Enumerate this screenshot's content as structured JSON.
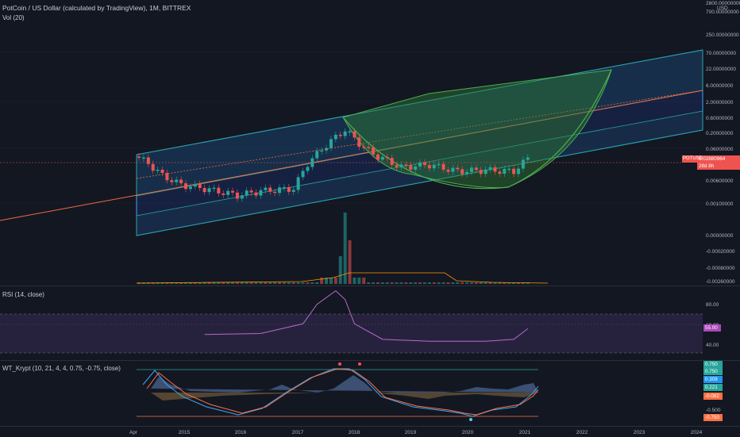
{
  "main": {
    "title": "PotCoin / US Dollar (calculated by TradingView), 1M, BITTREX",
    "volume_label": "Vol (20)",
    "price_axis_unit": "USD",
    "price_ticks": [
      "2800.00000000",
      "700.00000000",
      "250.00000000",
      "70.00000000",
      "22.00000000",
      "6.00000000",
      "2.00000000",
      "0.60000000",
      "0.20000000",
      "0.06000000",
      "0.02000000",
      "0.00600000",
      "0.00100000",
      "0.00000000",
      "-0.00020000",
      "-0.00080000",
      "-0.00260000"
    ],
    "price_tag": {
      "ticker": "POTUSD",
      "value": "0.02880964",
      "time_left": "28d 8h",
      "color": "#ef5350"
    },
    "time_ticks": [
      "Apr",
      "2015",
      "2016",
      "2017",
      "2018",
      "2019",
      "2020",
      "2021",
      "2022",
      "2023",
      "2024"
    ]
  },
  "rsi": {
    "label": "RSI (14, close)",
    "ticks": [
      "80.00",
      "60.00",
      "40.00"
    ],
    "current": "55.00",
    "band_color": "#7e57c2"
  },
  "wt": {
    "label": "WT_Krypt (10, 21, 4, 4, 0.75, -0.75, close)",
    "ticks": [
      "-0.500"
    ],
    "tags": [
      {
        "value": "0.750",
        "color": "#26a69a"
      },
      {
        "value": "0.750",
        "color": "#26a69a"
      },
      {
        "value": "0.308",
        "color": "#2196f3"
      },
      {
        "value": "0.221",
        "color": "#26a69a"
      },
      {
        "value": "-0.082",
        "color": "#ff7043"
      },
      {
        "value": "-0.750",
        "color": "#ff7043"
      }
    ]
  },
  "chart_data": {
    "type": "candlestick",
    "timeframe": "1M",
    "symbol": "POTUSD",
    "exchange": "BITTREX",
    "price_scale": "log",
    "x_range": [
      "2014-04",
      "2024-01"
    ],
    "candles_approx": [
      {
        "t": "2014-04",
        "close": 0.03
      },
      {
        "t": "2014-06",
        "close": 0.02
      },
      {
        "t": "2014-09",
        "close": 0.008
      },
      {
        "t": "2015-01",
        "close": 0.004
      },
      {
        "t": "2015-06",
        "close": 0.003
      },
      {
        "t": "2016-01",
        "close": 0.0018
      },
      {
        "t": "2016-06",
        "close": 0.0025
      },
      {
        "t": "2017-01",
        "close": 0.003
      },
      {
        "t": "2017-04",
        "close": 0.02
      },
      {
        "t": "2017-08",
        "close": 0.08
      },
      {
        "t": "2017-12",
        "close": 0.25
      },
      {
        "t": "2018-03",
        "close": 0.09
      },
      {
        "t": "2018-06",
        "close": 0.04
      },
      {
        "t": "2018-12",
        "close": 0.015
      },
      {
        "t": "2019-06",
        "close": 0.018
      },
      {
        "t": "2019-12",
        "close": 0.011
      },
      {
        "t": "2020-06",
        "close": 0.012
      },
      {
        "t": "2020-12",
        "close": 0.011
      },
      {
        "t": "2021-03",
        "close": 0.0288
      }
    ],
    "rsi_series_approx": [
      {
        "t": "2015-06",
        "v": 49
      },
      {
        "t": "2016-06",
        "v": 50
      },
      {
        "t": "2017-03",
        "v": 60
      },
      {
        "t": "2017-06",
        "v": 80
      },
      {
        "t": "2017-10",
        "v": 94
      },
      {
        "t": "2017-12",
        "v": 85
      },
      {
        "t": "2018-02",
        "v": 60
      },
      {
        "t": "2018-08",
        "v": 44
      },
      {
        "t": "2019-06",
        "v": 42
      },
      {
        "t": "2020-06",
        "v": 42
      },
      {
        "t": "2020-12",
        "v": 44
      },
      {
        "t": "2021-03",
        "v": 55
      }
    ],
    "rsi_bands": {
      "upper": 70,
      "middle": 50,
      "lower": 30
    },
    "wt_levels": {
      "upper": 0.75,
      "lower": -0.75
    }
  }
}
